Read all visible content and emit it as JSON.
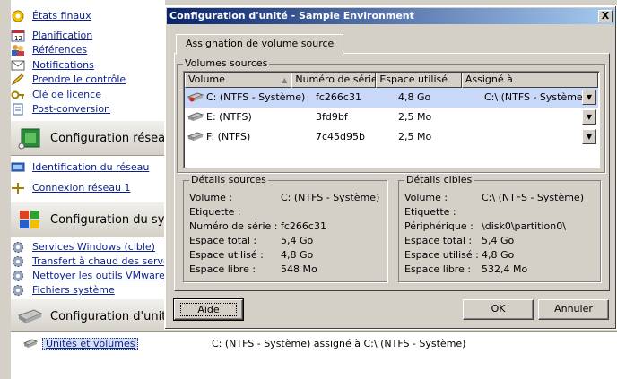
{
  "sidebar": {
    "items_top": [
      {
        "label": "États finaux",
        "icon": "state-icon"
      },
      {
        "label": "Planification",
        "icon": "calendar-icon"
      },
      {
        "label": "Références",
        "icon": "users-icon"
      },
      {
        "label": "Notifications",
        "icon": "envelope-icon"
      },
      {
        "label": "Prendre le contrôle",
        "icon": "pen-icon"
      },
      {
        "label": "Clé de licence",
        "icon": "key-icon"
      },
      {
        "label": "Post-conversion",
        "icon": "document-icon"
      }
    ],
    "group_network": "Configuration réseau",
    "items_network": [
      {
        "label": "Identification du réseau",
        "icon": "network-id-icon"
      },
      {
        "label": "Connexion réseau 1",
        "icon": "network-connection-icon"
      }
    ],
    "group_system": "Configuration du système",
    "items_system": [
      {
        "label": "Services Windows (cible)",
        "icon": "gear-icon"
      },
      {
        "label": "Transfert à chaud des serveurs",
        "icon": "gear-icon"
      },
      {
        "label": "Nettoyer les outils VMware",
        "icon": "gear-icon"
      },
      {
        "label": "Fichiers système",
        "icon": "gear-icon"
      }
    ],
    "group_unit": "Configuration d'unité",
    "selected_item": "Unités et volumes",
    "selected_description": "C: (NTFS - Système) assigné à C:\\ (NTFS - Système)"
  },
  "dialog": {
    "title": "Configuration d'unité - Sample Environment",
    "close_label": "X",
    "tab_label": "Assignation de volume source",
    "volumes_group_label": "Volumes sources",
    "columns": [
      "Volume",
      "Numéro de série",
      "Espace utilisé",
      "Assigné à"
    ],
    "rows": [
      {
        "volume": "C: (NTFS - Système)",
        "serial": "fc266c31",
        "used": "4,8 Go",
        "assigned": "C:\\ (NTFS - Système)"
      },
      {
        "volume": "E: (NTFS)",
        "serial": "3fd9bf",
        "used": "2,5 Mo",
        "assigned": ""
      },
      {
        "volume": "F: (NTFS)",
        "serial": "7c45d95b",
        "used": "2,5 Mo",
        "assigned": ""
      }
    ],
    "source_details": {
      "label": "Détails sources",
      "fields": [
        {
          "k": "Volume :",
          "v": "C: (NTFS - Système)"
        },
        {
          "k": "Etiquette :",
          "v": ""
        },
        {
          "k": "Numéro de série :",
          "v": "fc266c31"
        },
        {
          "k": "Espace total :",
          "v": "5,4 Go"
        },
        {
          "k": "Espace utilisé :",
          "v": "4,8 Go"
        },
        {
          "k": "Espace libre :",
          "v": "548 Mo"
        }
      ]
    },
    "target_details": {
      "label": "Détails cibles",
      "fields": [
        {
          "k": "Volume :",
          "v": "C:\\ (NTFS - Système)"
        },
        {
          "k": "Etiquette :",
          "v": ""
        },
        {
          "k": "Périphérique :",
          "v": "\\disk0\\partition0\\"
        },
        {
          "k": "Espace total :",
          "v": "5,4 Go"
        },
        {
          "k": "Espace utilisé :",
          "v": "4,8 Go"
        },
        {
          "k": "Espace libre :",
          "v": "532,4 Mo"
        }
      ]
    },
    "help_label": "Aide",
    "ok_label": "OK",
    "cancel_label": "Annuler"
  },
  "colors": {
    "titlebar_start": "#0a246a",
    "titlebar_end": "#a6caf0",
    "link": "#0a1f8f",
    "selection": "#c8d8f8"
  }
}
